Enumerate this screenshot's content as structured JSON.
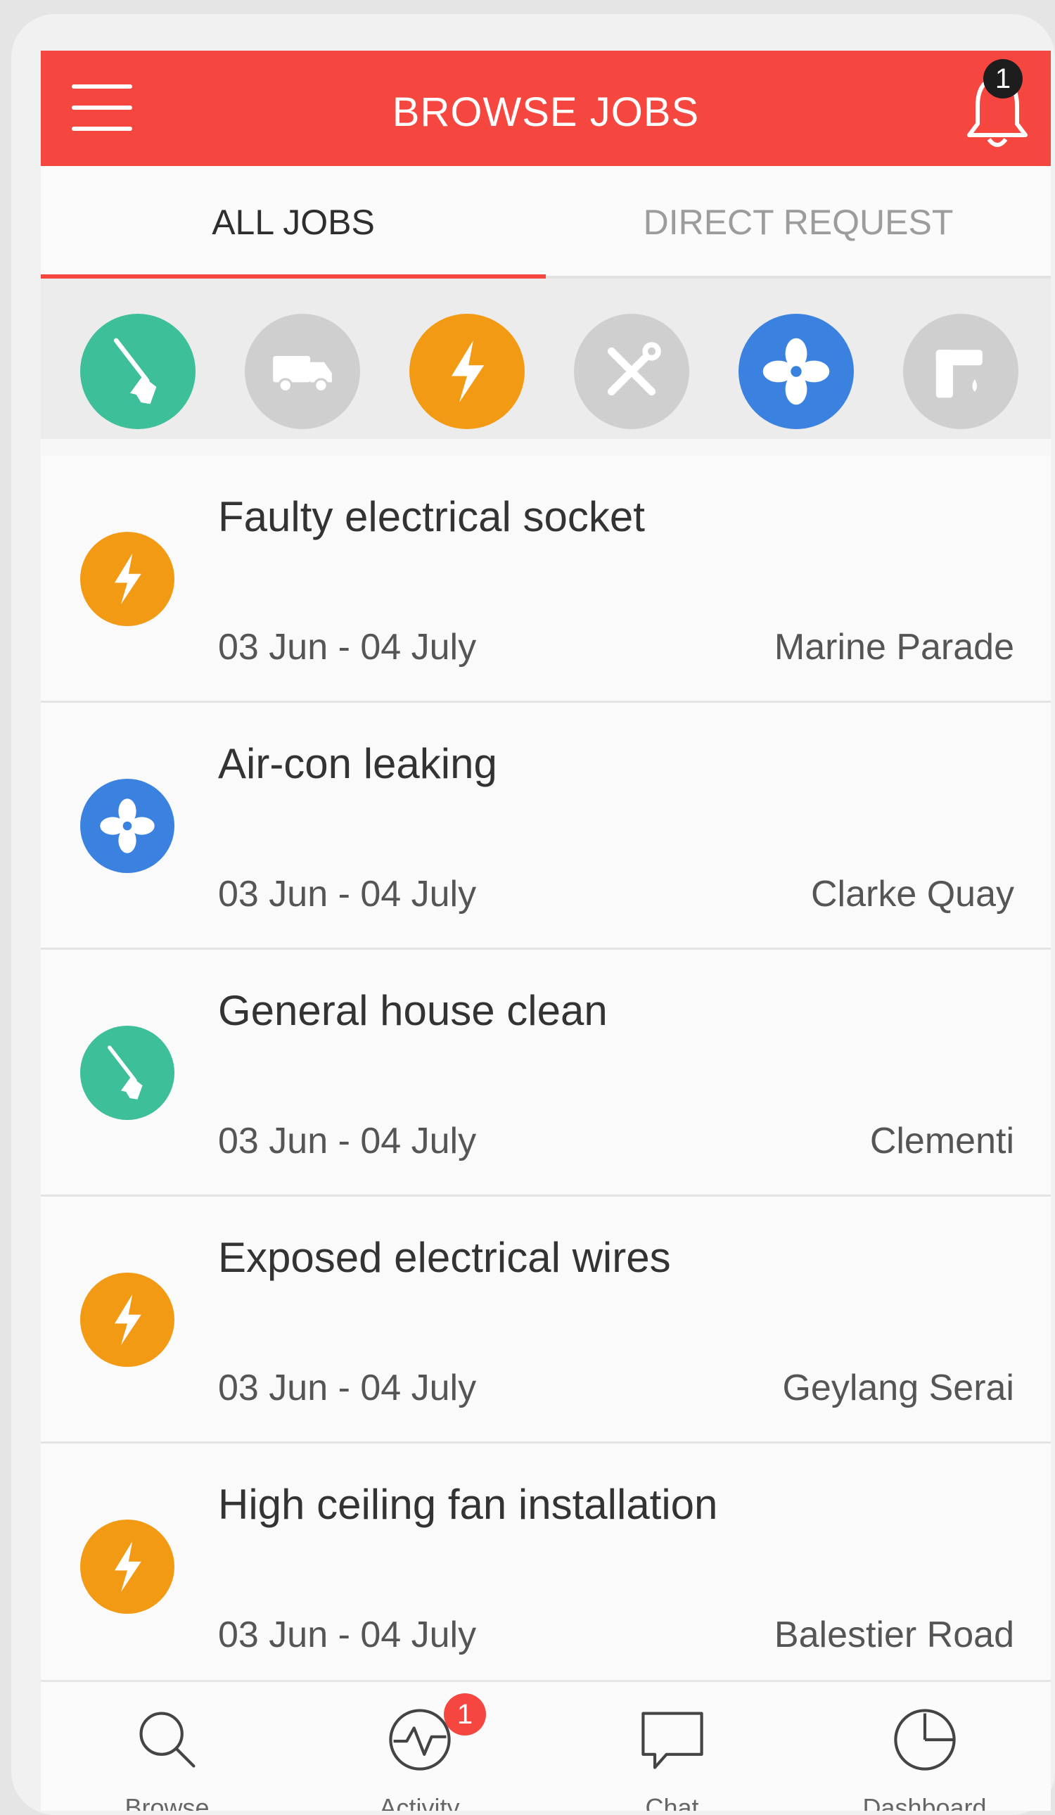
{
  "header": {
    "title": "BROWSE JOBS",
    "notification_count": "1"
  },
  "tabs": [
    {
      "label": "ALL JOBS",
      "active": true
    },
    {
      "label": "DIRECT REQUEST",
      "active": false
    }
  ],
  "categories": [
    {
      "icon": "broom-icon",
      "color": "#3dbf99",
      "active": true
    },
    {
      "icon": "truck-icon",
      "color": "#cfcfcf",
      "active": false
    },
    {
      "icon": "lightning-icon",
      "color": "#f39a14",
      "active": true
    },
    {
      "icon": "tools-icon",
      "color": "#cfcfcf",
      "active": false
    },
    {
      "icon": "fan-icon",
      "color": "#3b82e0",
      "active": true
    },
    {
      "icon": "faucet-icon",
      "color": "#cfcfcf",
      "active": false
    }
  ],
  "jobs": [
    {
      "title": "Faulty electrical socket",
      "date": "03 Jun - 04 July",
      "location": "Marine Parade",
      "icon": "lightning-icon"
    },
    {
      "title": "Air-con leaking",
      "date": "03 Jun - 04 July",
      "location": "Clarke Quay",
      "icon": "fan-icon"
    },
    {
      "title": "General house clean",
      "date": "03 Jun - 04 July",
      "location": "Clementi",
      "icon": "broom-icon"
    },
    {
      "title": "Exposed electrical wires",
      "date": "03 Jun - 04 July",
      "location": "Geylang Serai",
      "icon": "lightning-icon"
    },
    {
      "title": "High ceiling fan installation",
      "date": "03 Jun - 04 July",
      "location": "Balestier Road",
      "icon": "lightning-icon"
    }
  ],
  "bottom_nav": [
    {
      "label": "Browse",
      "icon": "search-icon"
    },
    {
      "label": "Activity",
      "icon": "activity-icon",
      "badge": "1"
    },
    {
      "label": "Chat",
      "icon": "chat-icon"
    },
    {
      "label": "Dashboard",
      "icon": "clock-icon"
    }
  ],
  "colors": {
    "brand": "#f5473f",
    "electrical": "#f39a14",
    "aircon": "#3b82e0",
    "cleaning": "#3dbf99",
    "inactive": "#cfcfcf"
  }
}
